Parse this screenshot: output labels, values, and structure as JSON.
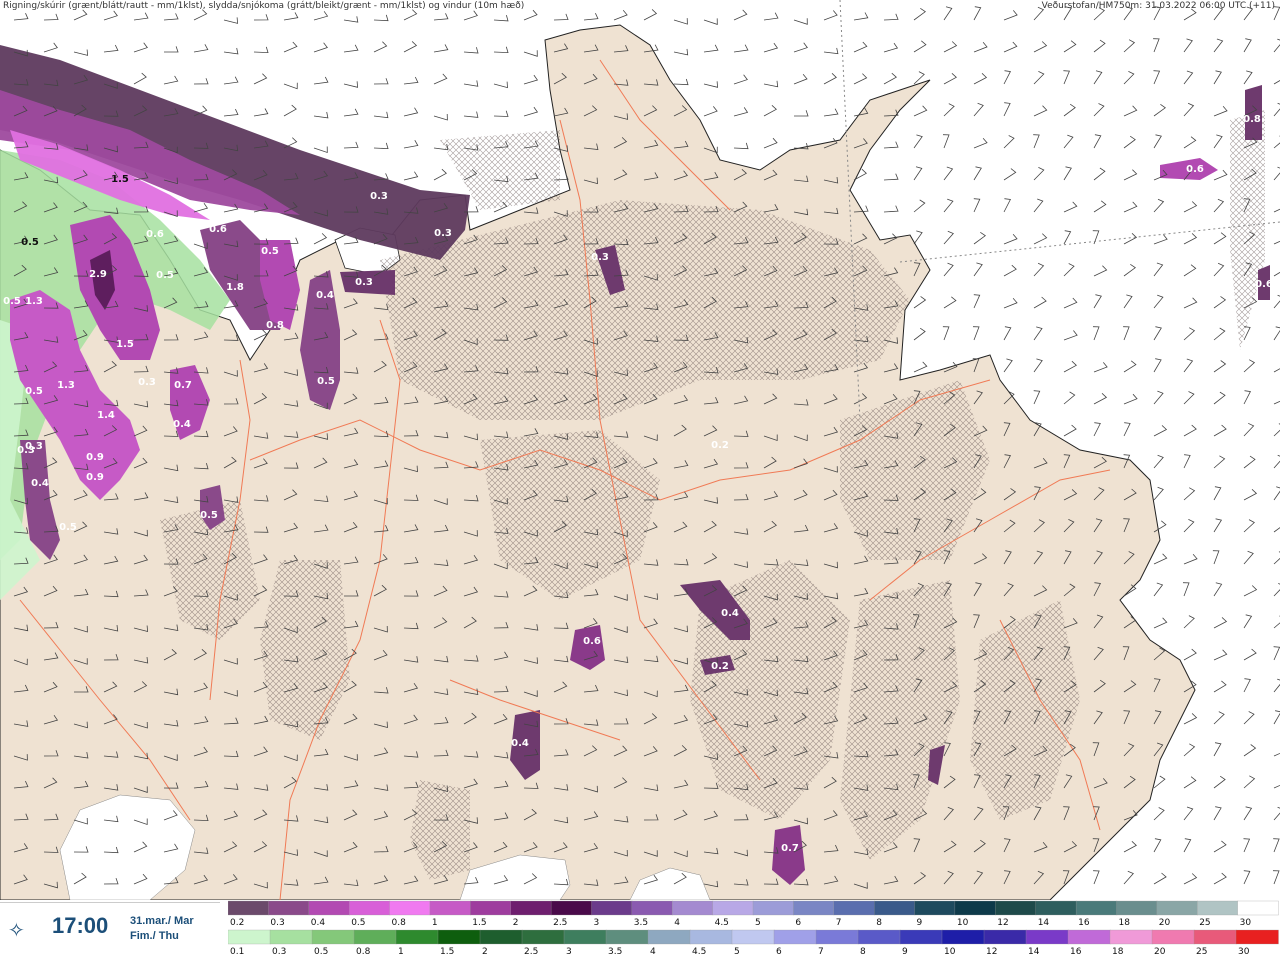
{
  "header": {
    "left": "Rigning/skúrir (grænt/blátt/rautt - mm/1klst), slydda/snjókoma (grátt/bleikt/grænt - mm/1klst) og vindur (10m hæð)",
    "right": "Veðurstofan/HM750m: 31.03.2022 06:00 UTC (+11)"
  },
  "time_panel": {
    "icon": "wind-compass-icon",
    "icon_glyph": "✧",
    "time": "17:00",
    "date_line1": "31.mar./ Mar",
    "date_line2": "Fim./ Thu"
  },
  "map": {
    "land_color": "#efe2d2",
    "coast_color": "#222222",
    "road_color": "#f07a55",
    "precip_labels": [
      "0.3",
      "0.3",
      "0.3",
      "1.5",
      "0.5",
      "0.6",
      "0.6",
      "0.6",
      "0.5",
      "2.9",
      "1.3",
      "0.5",
      "1.8",
      "0.4",
      "0.8",
      "0.5",
      "0.3",
      "0.7",
      "0.4",
      "1.5",
      "0.3",
      "0.9",
      "1.3",
      "0.5",
      "1.4",
      "0.3",
      "0.4",
      "0.9",
      "0.5",
      "0.5",
      "0.3",
      "0.2",
      "0.4",
      "0.6",
      "0.2",
      "0.4",
      "0.7",
      "0.6",
      "0.8",
      "0.6",
      "0.5"
    ]
  },
  "legend": {
    "snow_ticks": [
      "0.2",
      "0.3",
      "0.4",
      "0.5",
      "0.8",
      "1",
      "1.5",
      "2",
      "2.5",
      "3",
      "3.5",
      "4",
      "4.5",
      "5",
      "6",
      "7",
      "8",
      "9",
      "10",
      "12",
      "14",
      "16",
      "18",
      "20",
      "25",
      "30"
    ],
    "snow_colors": [
      "#6b4a6b",
      "#8a4a8a",
      "#b24ab2",
      "#d85fd8",
      "#f07af0",
      "#c65ac6",
      "#9e3c9e",
      "#6e1e6e",
      "#4a0a4a",
      "#6b3b8b",
      "#8a5ab0",
      "#a48ad0",
      "#b8a8e6",
      "#9c9cd8",
      "#7a86c4",
      "#5a6eae",
      "#3a5a8a",
      "#1e4a5e",
      "#0e3a4a",
      "#1e4a4a",
      "#2e5e5e",
      "#4a7a7a",
      "#6a8e8e",
      "#8aa6a6",
      "#b0c4c4",
      "#ffffff"
    ],
    "rain_ticks": [
      "0.1",
      "0.3",
      "0.5",
      "0.8",
      "1",
      "1.5",
      "2",
      "2.5",
      "3",
      "3.5",
      "4",
      "4.5",
      "5",
      "6",
      "7",
      "8",
      "9",
      "10",
      "12",
      "14",
      "16",
      "18",
      "20",
      "25",
      "30"
    ],
    "rain_colors": [
      "#cdf5cd",
      "#a6e0a0",
      "#84c87a",
      "#5fae5a",
      "#2e8a2e",
      "#0e5e0e",
      "#1e5e2e",
      "#2e6e3e",
      "#3e7e5e",
      "#5e8e7e",
      "#8ea8c0",
      "#a8b8e0",
      "#c0c8f0",
      "#a0a0e8",
      "#7a7ad8",
      "#5a5ac8",
      "#3a3ab8",
      "#1e1ea8",
      "#3a2aa8",
      "#7a3ac8",
      "#c06ad8",
      "#f09ad8",
      "#f07ab0",
      "#e85a7a",
      "#e82020"
    ]
  }
}
